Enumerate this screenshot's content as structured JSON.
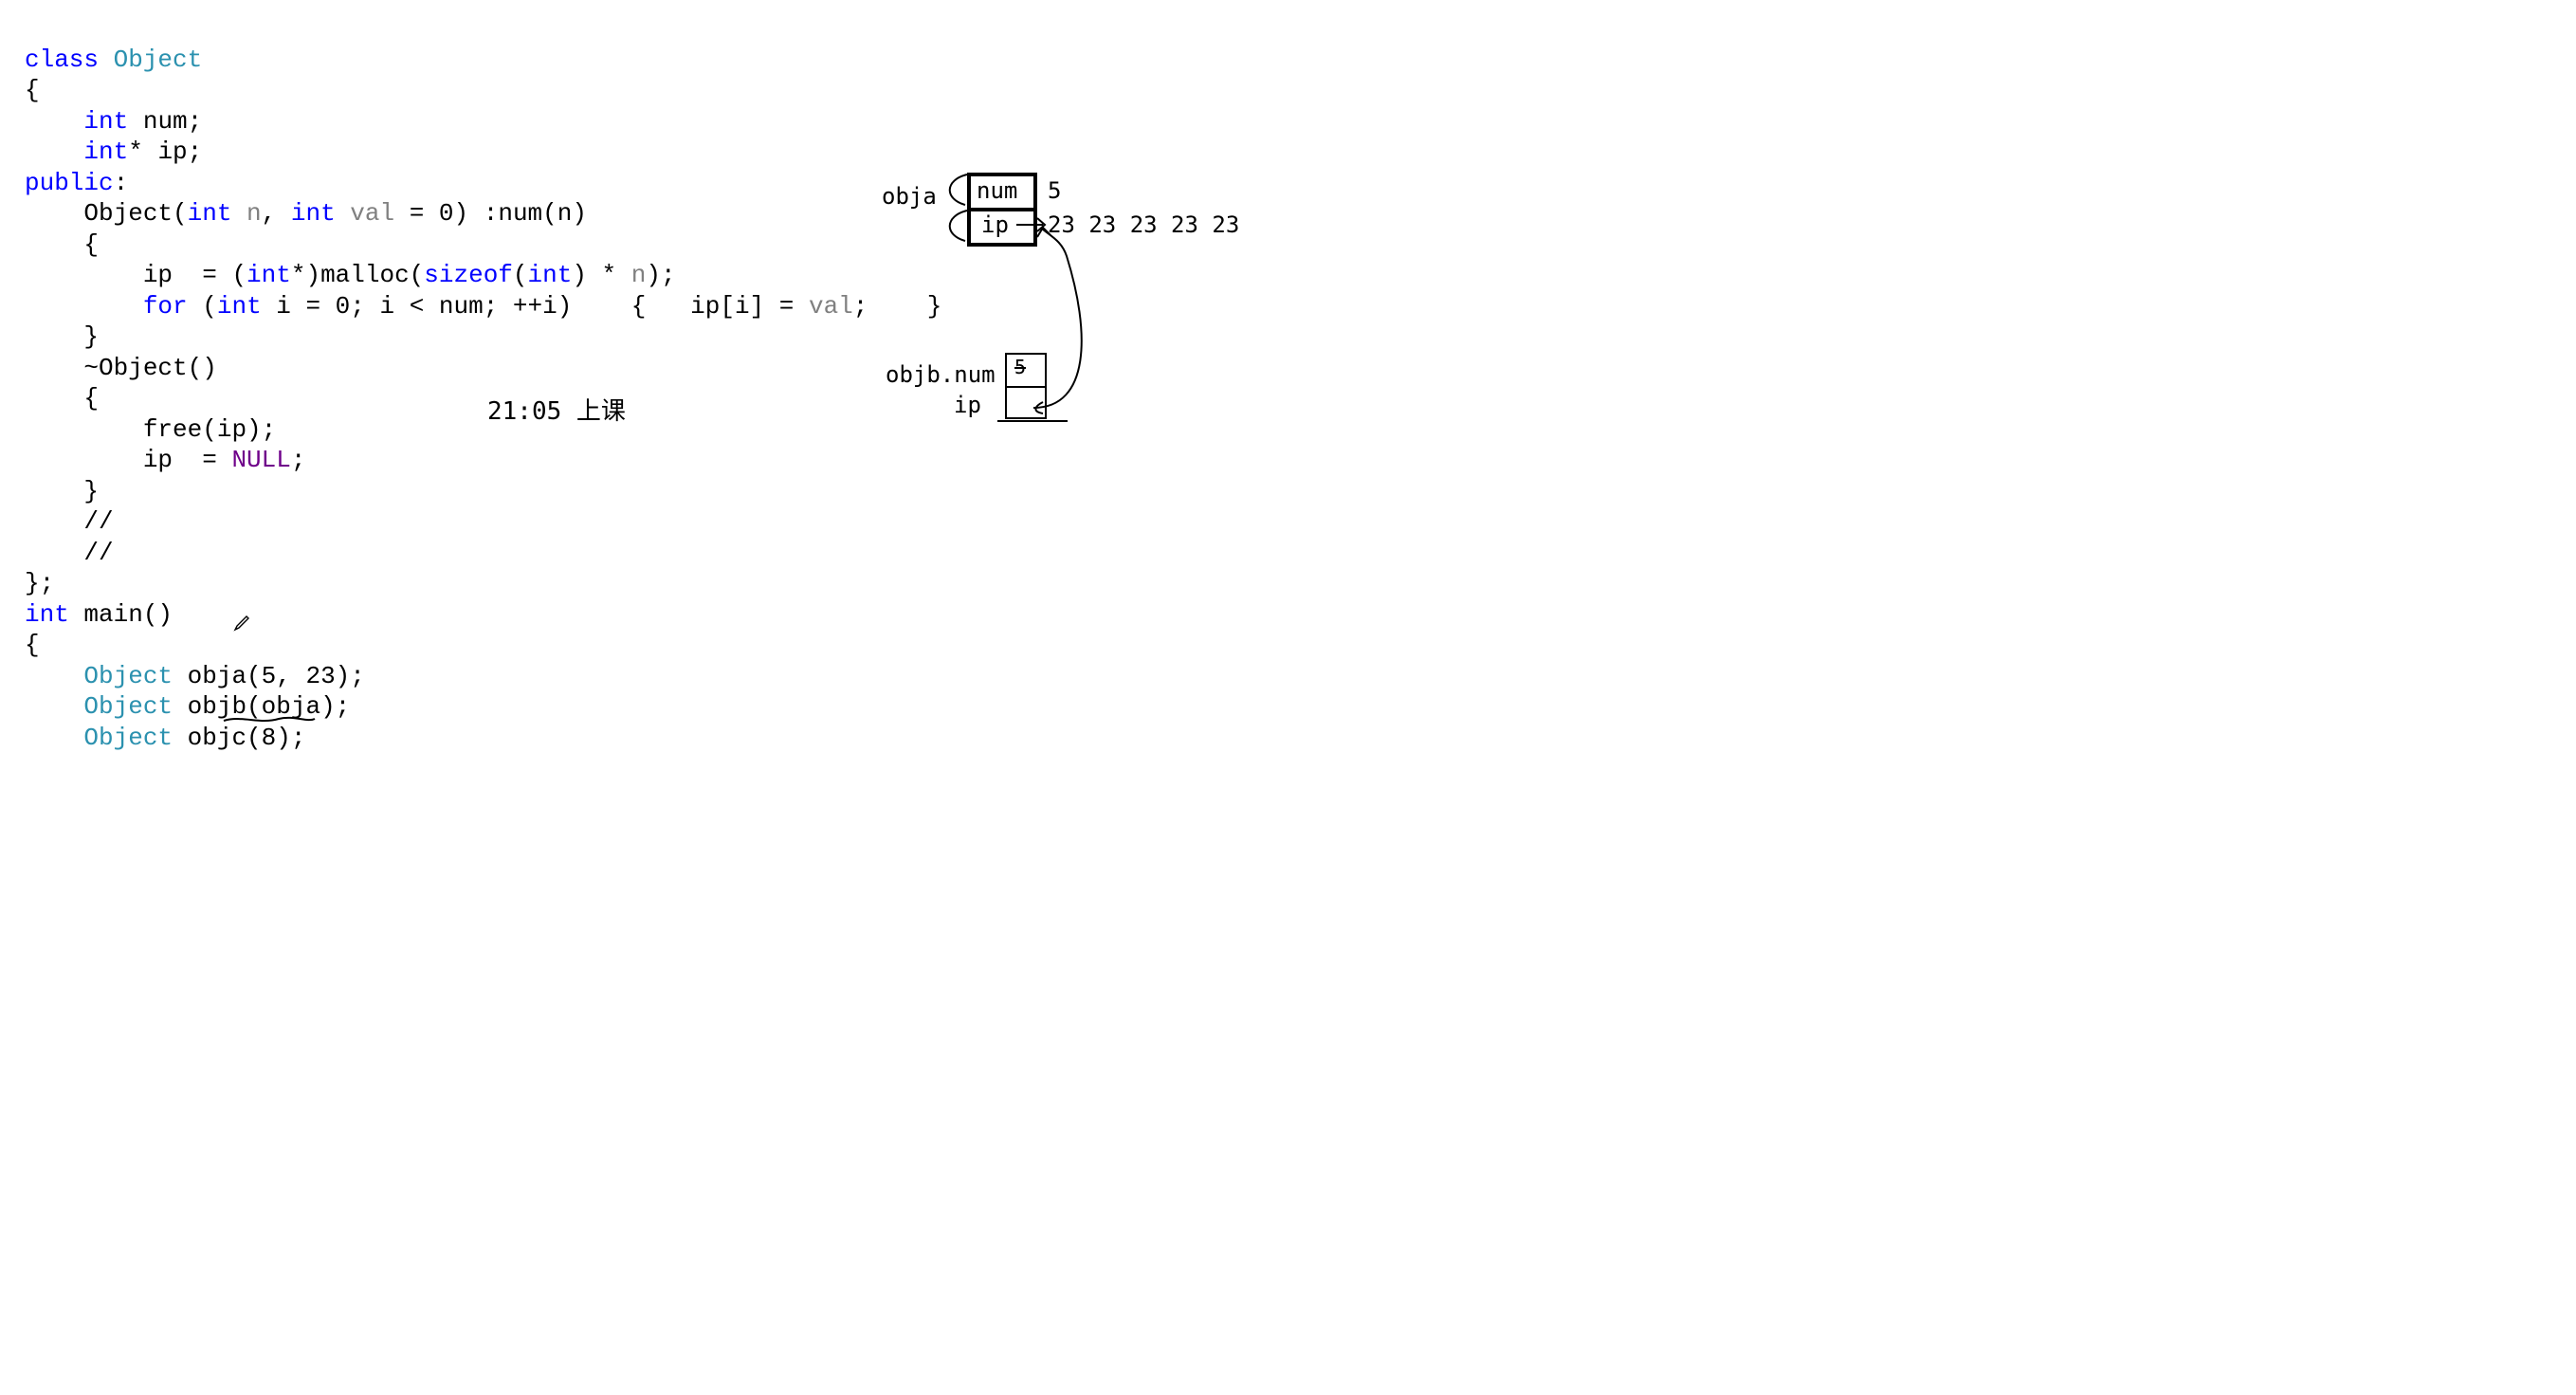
{
  "code": {
    "l1_class": "class",
    "l1_obj": "Object",
    "l2": "{",
    "l3_int": "int",
    "l3_rest": " num;",
    "l4_int": "int",
    "l4_rest": "* ip;",
    "l5_public": "public",
    "l5_colon": ":",
    "l6_ctor": "Object(",
    "l6_int1": "int",
    "l6_n": " n",
    "l6_comma": ", ",
    "l6_int2": "int",
    "l6_val": " val",
    "l6_eq": " = 0) :num(n)",
    "l7": "{",
    "l8_a": "ip  = (",
    "l8_int": "int",
    "l8_b": "*)malloc(",
    "l8_sizeof": "sizeof",
    "l8_c": "(",
    "l8_int2": "int",
    "l8_d": ") * ",
    "l8_n": "n",
    "l8_e": ");",
    "l9_for": "for",
    "l9_a": " (",
    "l9_int": "int",
    "l9_b": " i = 0; i < num; ++i)    {   ip[i] = ",
    "l9_val": "val",
    "l9_c": ";    }",
    "l10": "}",
    "l11": "~Object()",
    "l12": "{",
    "l13": "free(ip);",
    "l14_a": "ip  = ",
    "l14_null": "NULL",
    "l14_b": ";",
    "l15": "}",
    "l16": "//",
    "l17": "//",
    "l18": "};",
    "l19_int": "int",
    "l19_b": " main()",
    "l20": "{",
    "l21_obj": "Object",
    "l21_b": " obja(5, 23);",
    "l22_obj": "Object",
    "l22_b": " objb(obja);",
    "l23_obj": "Object",
    "l23_b": " objc(8);"
  },
  "reminder": "21:05 上课",
  "diagram": {
    "obja_label": "obja",
    "num_label": "num",
    "ip_label": "ip",
    "five": "5",
    "array": "23 23 23 23 23",
    "objb_num": "objb.num",
    "objb_ip": "ip",
    "five2": "5"
  }
}
